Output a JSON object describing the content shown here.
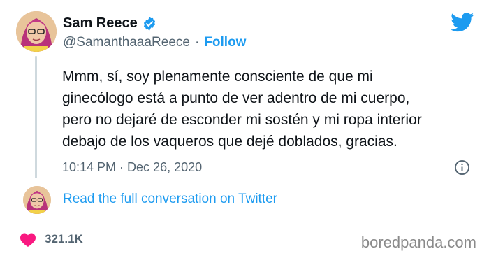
{
  "author": {
    "name": "Sam Reece",
    "handle": "@SamanthaaaReece",
    "separator": "·",
    "follow_label": "Follow"
  },
  "tweet": {
    "text": "Mmm, sí, soy plenamente consciente de que mi\nginecólogo está a punto de ver adentro de mi cuerpo,\npero no dejaré de esconder mi sostén y mi ropa interior\ndebajo de los vaqueros que dejé doblados, gracias.",
    "timestamp": "10:14 PM · Dec 26, 2020"
  },
  "conversation_link": "Read the full conversation on Twitter",
  "likes": "321.1K",
  "watermark": "boredpanda.com",
  "colors": {
    "accent": "#1d9bf0",
    "like_heart": "#f91880",
    "text_secondary": "#536471"
  },
  "icons": {
    "verified": "verified-badge-icon",
    "brand": "twitter-bird-icon",
    "info": "info-icon",
    "like": "heart-icon"
  }
}
